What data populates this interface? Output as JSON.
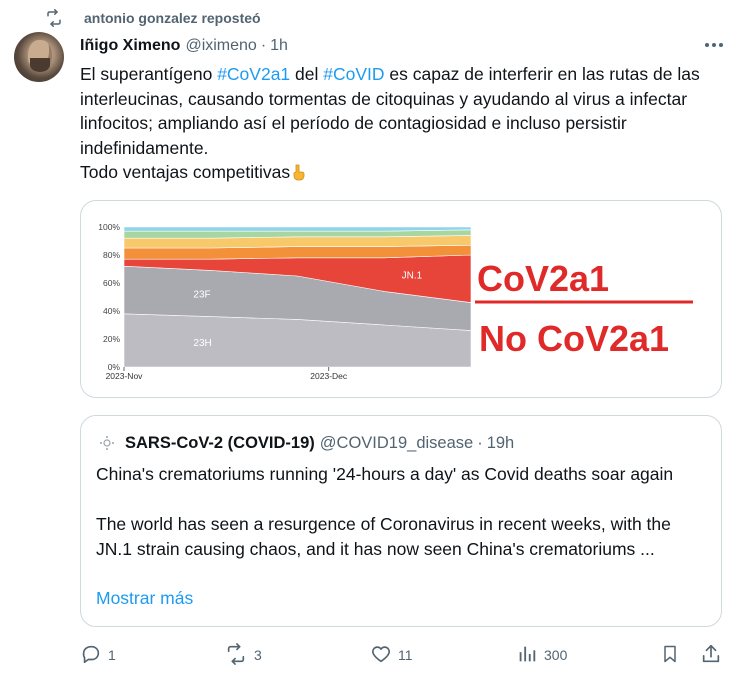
{
  "repost": {
    "text": "antonio gonzalez reposteó",
    "icon": "repost-icon"
  },
  "tweet": {
    "author_name": "Iñigo Ximeno",
    "handle": "@iximeno",
    "separator": "·",
    "time": "1h",
    "text_segments": [
      {
        "t": "El superantígeno "
      },
      {
        "t": "#CoV2a1",
        "tag": true
      },
      {
        "t": " del "
      },
      {
        "t": "#CoVID",
        "tag": true
      },
      {
        "t": " es capaz de interferir en las rutas de las interleucinas, causando tormentas de citoquinas y ayudando al virus a infectar linfocitos; ampliando así el período de contagiosidad e incluso persistir indefinidamente."
      },
      {
        "br": true
      },
      {
        "t": "Todo ventajas competitivas"
      },
      {
        "emoji": "pointing-down-emoji"
      }
    ]
  },
  "media": {
    "right_top": "CoV2a1",
    "right_bottom": "No CoV2a1",
    "accent_red": "#e02a2a"
  },
  "chart_data": {
    "type": "area",
    "stacked": true,
    "normalized": true,
    "x_ticks": [
      "2023-Nov",
      "2023-Dec"
    ],
    "y_ticks": [
      "0%",
      "20%",
      "40%",
      "60%",
      "80%",
      "100%"
    ],
    "ylim": [
      0,
      100
    ],
    "x": [
      0,
      0.25,
      0.5,
      0.75,
      1.0
    ],
    "series": [
      {
        "name": "23H",
        "values": [
          38,
          36,
          34,
          30,
          26
        ],
        "color": "#bcbcc2"
      },
      {
        "name": "23F",
        "values": [
          34,
          33,
          31,
          24,
          20
        ],
        "color": "#a9a9b0"
      },
      {
        "name": "JN.1",
        "values": [
          5,
          8,
          13,
          24,
          34
        ],
        "color": "#e8453a"
      },
      {
        "name": "",
        "values": [
          8,
          8,
          8,
          8,
          7
        ],
        "color": "#f3913a"
      },
      {
        "name": "",
        "values": [
          7,
          7,
          7,
          7,
          7
        ],
        "color": "#f8c96b"
      },
      {
        "name": "",
        "values": [
          5,
          5,
          4,
          4,
          4
        ],
        "color": "#a8d6a0"
      },
      {
        "name": "",
        "values": [
          3,
          3,
          3,
          3,
          2
        ],
        "color": "#8fd4ea"
      }
    ],
    "labels": [
      {
        "text": "JN.1",
        "series": 2,
        "x": 0.8
      },
      {
        "text": "23F",
        "series": 1,
        "x": 0.2
      },
      {
        "text": "23H",
        "series": 0,
        "x": 0.2
      }
    ]
  },
  "quote": {
    "author_name": "SARS-CoV-2 (COVID-19)",
    "handle": "@COVID19_disease",
    "separator": "·",
    "time": "19h",
    "title": "China's crematoriums running '24-hours a day' as Covid deaths soar again",
    "body": "The world has seen a resurgence of Coronavirus in recent weeks, with the JN.1 strain causing chaos, and it has now seen China's crematoriums ...",
    "show_more": "Mostrar más"
  },
  "actions": {
    "reply_count": "1",
    "repost_count": "3",
    "like_count": "11",
    "views_count": "300"
  }
}
